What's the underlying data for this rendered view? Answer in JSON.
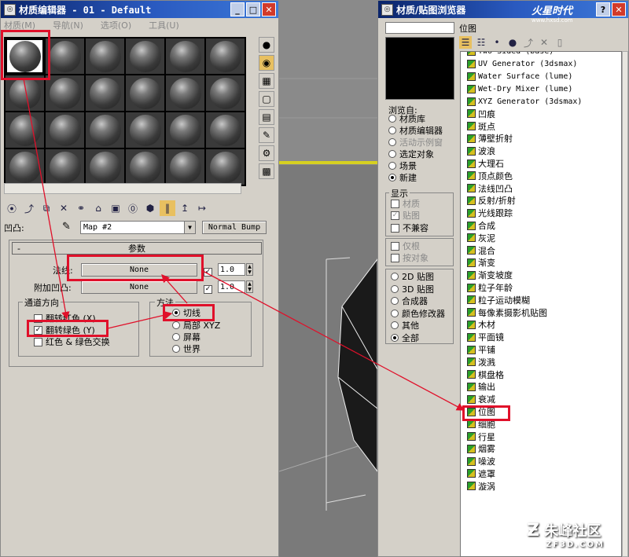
{
  "material_editor": {
    "title": "材质编辑器 - 01 - Default",
    "menu": [
      "材质(M)",
      "导航(N)",
      "选项(O)",
      "工具(U)"
    ],
    "side_buttons": [
      "sample-type",
      "backlight",
      "background",
      "uv-tiling",
      "video-color-check",
      "make-preview",
      "options"
    ],
    "toolbar_buttons": [
      "get-material",
      "put-to-scene",
      "assign-to-selection",
      "reset",
      "copy",
      "unique",
      "put-to-library",
      "material-id",
      "show-in-viewport",
      "show-end-result",
      "go-to-parent",
      "go-forward"
    ],
    "bump_label": "凹凸:",
    "map_name": "Map #2",
    "map_type": "Normal Bump",
    "params_title": "参数",
    "collapse_sign": "-",
    "normal_label": "法线:",
    "normal_value": "None",
    "normal_amount": "1.0",
    "add_bump_label": "附加凹凸:",
    "add_bump_value": "None",
    "add_bump_amount": "1.0",
    "channel_group": "通道方向",
    "flip_red": "翻转红色 (X)",
    "flip_green": "翻转绿色 (Y)",
    "swap_rg": "红色 & 绿色交换",
    "method_group": "方法",
    "method_options": [
      "切线",
      "局部 XYZ",
      "屏幕",
      "世界"
    ],
    "method_selected": 0,
    "flip_green_checked": true,
    "normal_checked": true,
    "add_bump_checked": true
  },
  "browser": {
    "title": "材质/贴图浏览器",
    "path_label": "位图",
    "browse_from_label": "浏览自:",
    "browse_from": [
      "材质库",
      "材质编辑器",
      "活动示例窗",
      "选定对象",
      "场景",
      "新建"
    ],
    "browse_from_selected": 5,
    "show_label": "显示",
    "show_options": [
      "材质",
      "贴图",
      "不兼容"
    ],
    "show_checked": [
      false,
      true,
      false
    ],
    "root_only": "仅根",
    "by_object": "按对象",
    "filter_options": [
      "2D 贴图",
      "3D 贴图",
      "合成器",
      "颜色修改器",
      "其他",
      "全部"
    ],
    "filter_selected": 5,
    "map_list": [
      {
        "label": "Two Sided (base)",
        "mono": true
      },
      {
        "label": "UV Generator (3dsmax)",
        "mono": true
      },
      {
        "label": "Water Surface (lume)",
        "mono": true
      },
      {
        "label": "Wet-Dry Mixer (lume)",
        "mono": true
      },
      {
        "label": "XYZ Generator (3dsmax)",
        "mono": true
      },
      {
        "label": "凹痕"
      },
      {
        "label": "斑点"
      },
      {
        "label": "薄壁折射"
      },
      {
        "label": "波浪"
      },
      {
        "label": "大理石"
      },
      {
        "label": "顶点颜色"
      },
      {
        "label": "法线凹凸"
      },
      {
        "label": "反射/折射"
      },
      {
        "label": "光线跟踪"
      },
      {
        "label": "合成"
      },
      {
        "label": "灰泥"
      },
      {
        "label": "混合"
      },
      {
        "label": "渐变"
      },
      {
        "label": "渐变坡度"
      },
      {
        "label": "粒子年龄"
      },
      {
        "label": "粒子运动模糊"
      },
      {
        "label": "每像素摄影机贴图"
      },
      {
        "label": "木材"
      },
      {
        "label": "平面镜"
      },
      {
        "label": "平铺"
      },
      {
        "label": "泼溅"
      },
      {
        "label": "棋盘格"
      },
      {
        "label": "输出"
      },
      {
        "label": "衰减"
      },
      {
        "label": "位图"
      },
      {
        "label": "细胞"
      },
      {
        "label": "行星"
      },
      {
        "label": "烟雾"
      },
      {
        "label": "噪波"
      },
      {
        "label": "遮罩"
      },
      {
        "label": "漩涡"
      }
    ]
  },
  "watermarks": {
    "top": "火星时代",
    "top_url": "www.hxsd.com",
    "bottom": "朱峰社区",
    "bottom_url": "ZF3D.COM"
  },
  "colors": {
    "highlight": "#e0102a",
    "title_bar": "#0a246a"
  }
}
